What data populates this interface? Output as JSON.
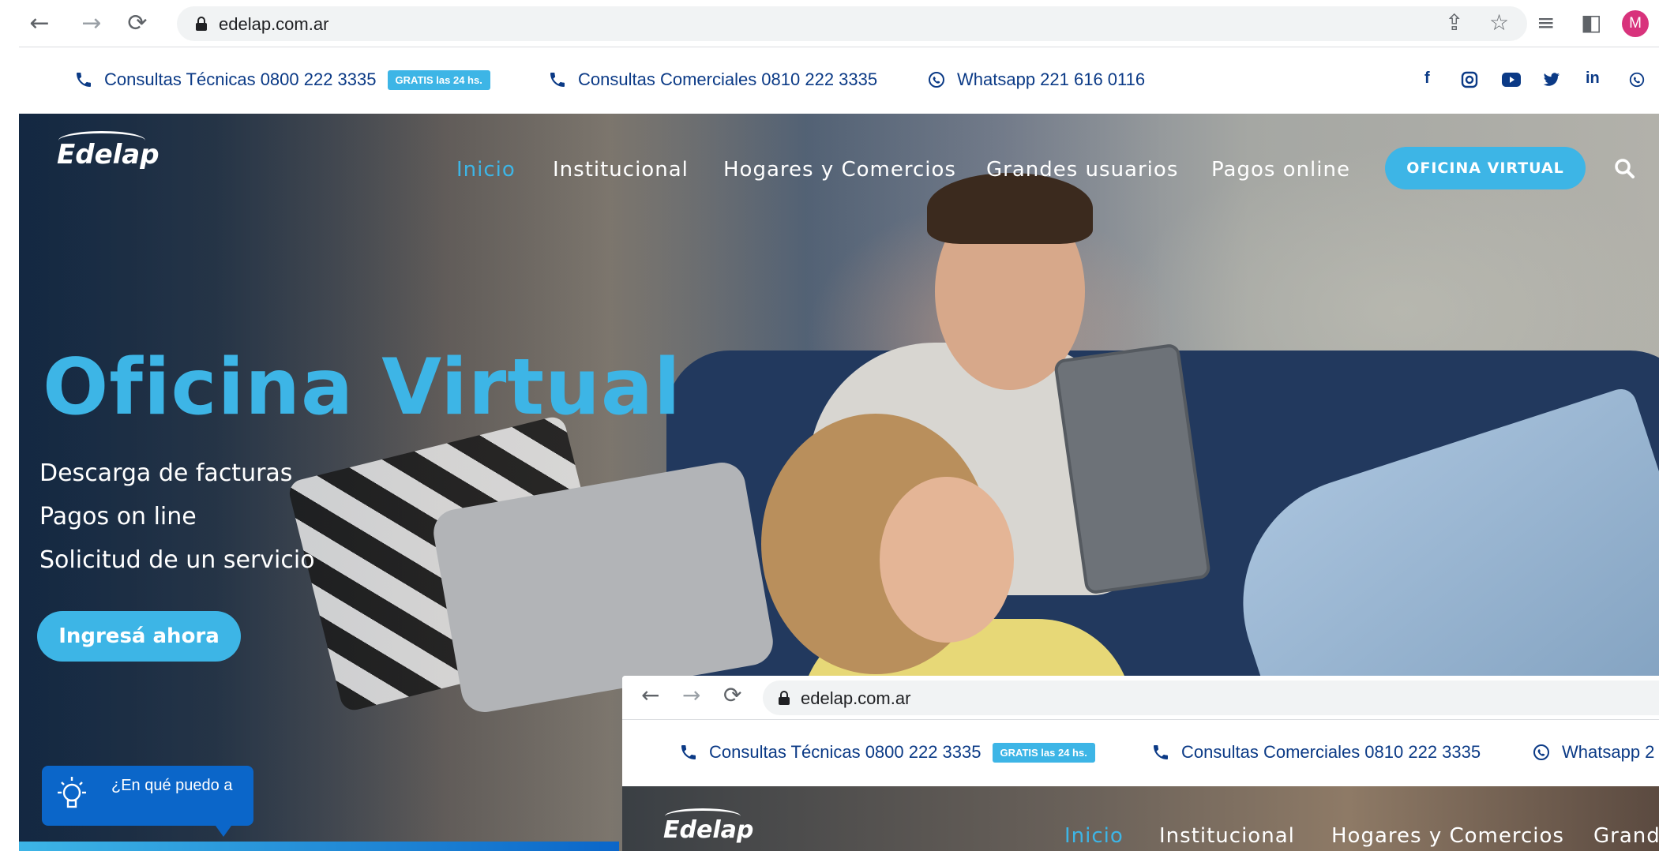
{
  "browser": {
    "url": "edelap.com.ar",
    "avatar_initial": "M",
    "icons": [
      "back-arrow-icon",
      "forward-arrow-icon",
      "reload-icon",
      "share-icon",
      "bookmark-star-icon",
      "reading-list-icon",
      "side-panel-icon"
    ]
  },
  "topbar": {
    "tecnicas": "Consultas Técnicas 0800 222 3335",
    "gratis": "GRATIS las 24 hs.",
    "comerciales": "Consultas Comerciales 0810 222 3335",
    "whatsapp": "Whatsapp 221 616 0116",
    "social": [
      "f",
      "in"
    ]
  },
  "header": {
    "logo": "Edelap",
    "nav": [
      "Inicio",
      "Institucional",
      "Hogares y Comercios",
      "Grandes usuarios",
      "Pagos online"
    ],
    "oficina_button": "OFICINA VIRTUAL"
  },
  "hero": {
    "title": "Oficina Virtual",
    "items": [
      "Descarga de facturas",
      "Pagos on line",
      "Solicitud de un servicio"
    ],
    "cta": "Ingresá ahora"
  },
  "chat": {
    "text": "¿En qué puedo a"
  },
  "inset": {
    "url": "edelap.com.ar",
    "tecnicas": "Consultas Técnicas 0800 222 3335",
    "gratis": "GRATIS las 24 hs.",
    "comerciales": "Consultas Comerciales 0810 222 3335",
    "whatsapp": "Whatsapp 2",
    "logo": "Edelap",
    "nav": [
      "Inicio",
      "Institucional",
      "Hogares y Comercios",
      "Grand"
    ]
  },
  "colors": {
    "accent": "#3db5e6",
    "navy": "#0b3a86",
    "chat_blue": "#0b66c9",
    "avatar": "#d8337c"
  }
}
